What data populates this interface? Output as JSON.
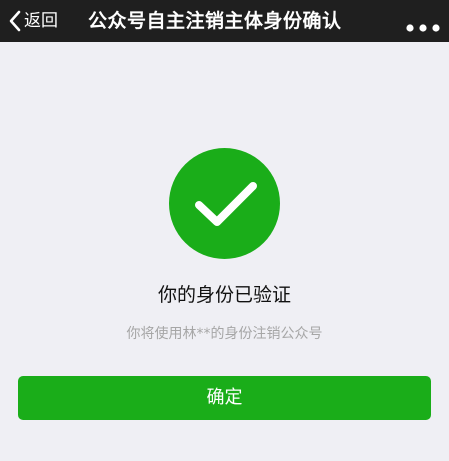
{
  "navbar": {
    "back_label": "返回",
    "back_icon": "chevron-left-icon",
    "title": "公众号自主注销主体身份确认",
    "more_icon": "more-dots-icon",
    "background_color": "#1f1f1f"
  },
  "main": {
    "status_icon": "success-check-icon",
    "status_icon_color": "#1aad19",
    "headline": "你的身份已验证",
    "subtext": "你将使用林**的身份注销公众号",
    "confirm_label": "确定",
    "confirm_color": "#1aad19"
  }
}
